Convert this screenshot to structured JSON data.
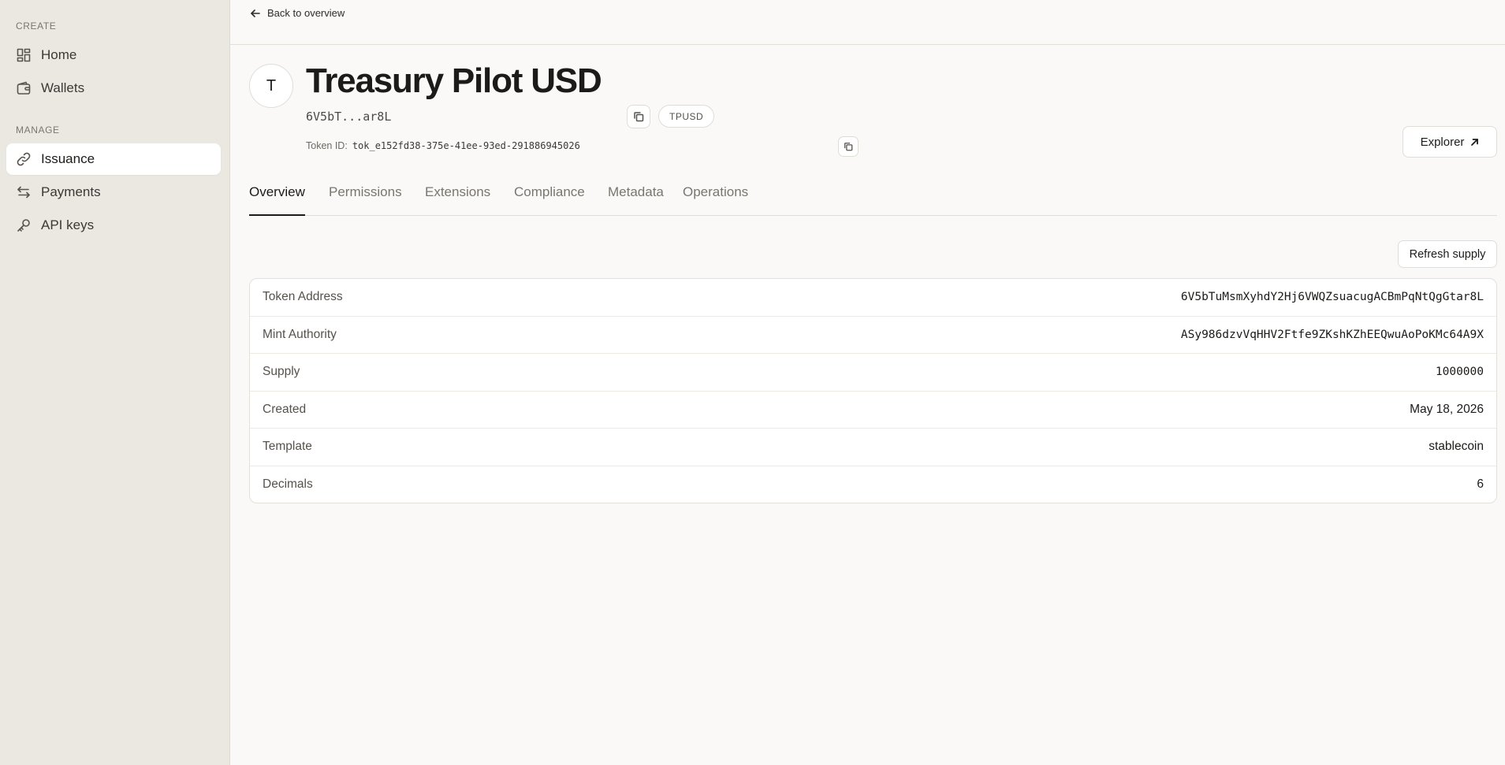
{
  "sidebar": {
    "create_label": "CREATE",
    "manage_label": "MANAGE",
    "items": [
      {
        "label": "Home",
        "icon": "dashboard-icon"
      },
      {
        "label": "Wallets",
        "icon": "wallet-icon"
      },
      {
        "label": "Issuance",
        "icon": "link-icon",
        "active": true
      },
      {
        "label": "Payments",
        "icon": "transfer-icon"
      },
      {
        "label": "API keys",
        "icon": "key-icon"
      }
    ]
  },
  "header": {
    "back_label": "Back to overview",
    "avatar_letter": "T",
    "title": "Treasury Pilot USD",
    "address_short": "6V5bT...ar8L",
    "symbol": "TPUSD",
    "token_id_label": "Token ID:",
    "token_id_value": "tok_e152fd38-375e-41ee-93ed-291886945026",
    "explorer_label": "Explorer"
  },
  "tabs": [
    {
      "label": "Overview",
      "active": true
    },
    {
      "label": "Permissions"
    },
    {
      "label": "Extensions"
    },
    {
      "label": "Compliance"
    },
    {
      "label": "Metadata"
    },
    {
      "label": "Operations"
    }
  ],
  "refresh_label": "Refresh supply",
  "details": [
    {
      "label": "Token Address",
      "value": "6V5bTuMsmXyhdY2Hj6VWQZsuacugACBmPqNtQgGtar8L",
      "mono": true
    },
    {
      "label": "Mint Authority",
      "value": "ASy986dzvVqHHV2Ftfe9ZKshKZhEEQwuAoPoKMc64A9X",
      "mono": true
    },
    {
      "label": "Supply",
      "value": "1000000",
      "mono": true
    },
    {
      "label": "Created",
      "value": "May 18, 2026"
    },
    {
      "label": "Template",
      "value": "stablecoin"
    },
    {
      "label": "Decimals",
      "value": "6"
    }
  ],
  "colors": {
    "sidebar_bg": "#ebe8e2",
    "page_bg": "#faf9f7",
    "text": "#1c1b19",
    "muted": "#7a766f"
  }
}
